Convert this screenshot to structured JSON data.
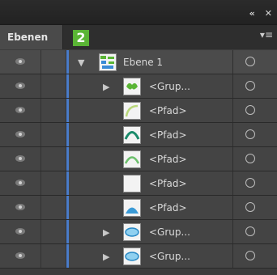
{
  "window": {
    "collapse_glyph": "«",
    "close_glyph": "✕"
  },
  "tabs": [
    {
      "label": "Ebenen"
    }
  ],
  "callout": "2",
  "panel_menu_glyph": "▾≡",
  "colors": {
    "selection_bar": "#4a7bc8",
    "callout": "#5ab535"
  },
  "layers": [
    {
      "label": "Ebene 1",
      "expanded": true,
      "icon": "layer-thumb-icon"
    },
    {
      "label": "<Grup...",
      "expanded": false,
      "icon": "group-thumb-icon"
    },
    {
      "label": "<Pfad>",
      "icon": "path-arc-light-icon"
    },
    {
      "label": "<Pfad>",
      "icon": "path-arc-dark-icon"
    },
    {
      "label": "<Pfad>",
      "icon": "path-arc-mid-icon"
    },
    {
      "label": "<Pfad>",
      "icon": "path-empty-icon"
    },
    {
      "label": "<Pfad>",
      "icon": "path-mound-icon"
    },
    {
      "label": "<Grup...",
      "expanded": false,
      "icon": "group-ellipse-icon"
    },
    {
      "label": "<Grup...",
      "expanded": false,
      "icon": "group-ellipse-icon"
    }
  ]
}
